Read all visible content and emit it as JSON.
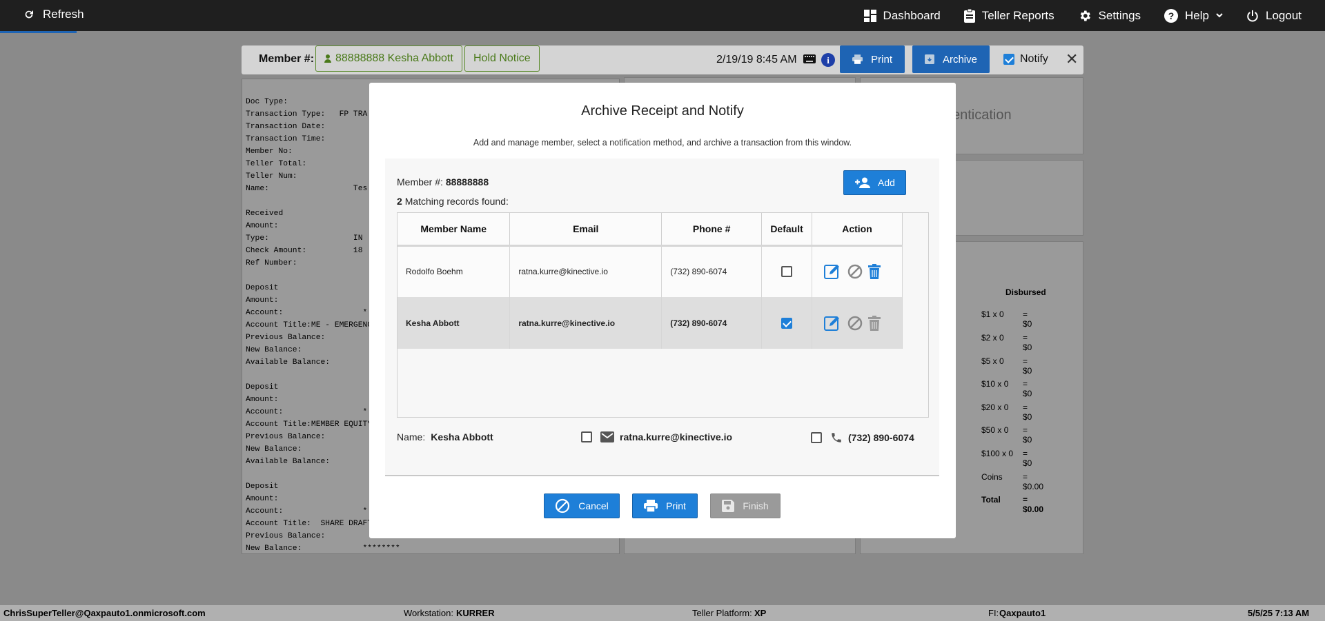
{
  "topbar": {
    "refresh_label": "Refresh",
    "nav": [
      {
        "label": "Dashboard",
        "icon": "dashboard-icon"
      },
      {
        "label": "Teller Reports",
        "icon": "clipboard-icon"
      },
      {
        "label": "Settings",
        "icon": "gear-icon"
      },
      {
        "label": "Help",
        "icon": "help-icon"
      },
      {
        "label": "Logout",
        "icon": "power-icon"
      }
    ]
  },
  "background": {
    "member_label": "Member #:",
    "member_chip": "88888888 Kesha Abbott",
    "hold_notice": "Hold Notice",
    "datetime": "2/19/19 8:45 AM",
    "print_label": "Print",
    "archive_label": "Archive",
    "notify_label": "Notify",
    "auth_text": "entication",
    "receipt_text": "Doc Type:\nTransaction Type:   FP TRA\nTransaction Date:\nTransaction Time:\nMember No:\nTeller Total:\nTeller Num:\nName:                  Tes\n\nReceived\nAmount:\nType:                  IN\nCheck Amount:          18\nRef Number:\n\nDeposit\nAmount:\nAccount:                 *\nAccount Title:ME - EMERGENC\nPrevious Balance:\nNew Balance:\nAvailable Balance:\n\nDeposit\nAmount:\nAccount:                 *\nAccount Title:MEMBER EQUITY\nPrevious Balance:\nNew Balance:\nAvailable Balance:\n\nDeposit\nAmount:\nAccount:                 *\nAccount Title:  SHARE DRAFT\nPrevious Balance:\nNew Balance:             ********",
    "disbursed_title": "Disbursed",
    "disbursed": [
      {
        "label": "$1 x 0",
        "value": "= $0"
      },
      {
        "label": "$2 x 0",
        "value": "= $0"
      },
      {
        "label": "$5 x 0",
        "value": "= $0"
      },
      {
        "label": "$10 x 0",
        "value": "= $0"
      },
      {
        "label": "$20 x 0",
        "value": "= $0"
      },
      {
        "label": "$50 x 0",
        "value": "= $0"
      },
      {
        "label": "$100 x 0",
        "value": "= $0"
      },
      {
        "label": "Coins",
        "value": "= $0.00"
      },
      {
        "label": "Total",
        "value": "= $0.00"
      }
    ]
  },
  "modal": {
    "title": "Archive Receipt and Notify",
    "subtitle": "Add and manage member, select a notification method, and archive a transaction from this window.",
    "member_label": "Member #:",
    "member_number": "88888888",
    "match_count": "2",
    "match_text": "Matching records found:",
    "add_label": "Add",
    "columns": [
      "Member Name",
      "Email",
      "Phone #",
      "Default",
      "Action"
    ],
    "rows": [
      {
        "name": "Rodolfo Boehm",
        "email": "ratna.kurre@kinective.io",
        "phone": "(732) 890-6074",
        "default": false
      },
      {
        "name": "Kesha Abbott",
        "email": "ratna.kurre@kinective.io",
        "phone": "(732) 890-6074",
        "default": true
      }
    ],
    "name_label": "Name:",
    "selected_name": "Kesha Abbott",
    "selected_email": "ratna.kurre@kinective.io",
    "selected_phone": "(732) 890-6074",
    "cancel_label": "Cancel",
    "print_label": "Print",
    "finish_label": "Finish"
  },
  "footer": {
    "user": "ChrisSuperTeller@Qaxpauto1.onmicrosoft.com",
    "workstation_label": "Workstation:",
    "workstation": "KURRER",
    "platform_label": "Teller Platform:",
    "platform": "XP",
    "fi_label": "FI:",
    "fi": "Qaxpauto1",
    "datetime": "5/5/25 7:13 AM"
  },
  "colors": {
    "accent": "#1e7fd8",
    "topbar": "#1f1f1f",
    "overlay_bg": "#8a8a8a",
    "chip_green": "#4a7a1a",
    "finish_disabled": "#9a9a9a"
  }
}
